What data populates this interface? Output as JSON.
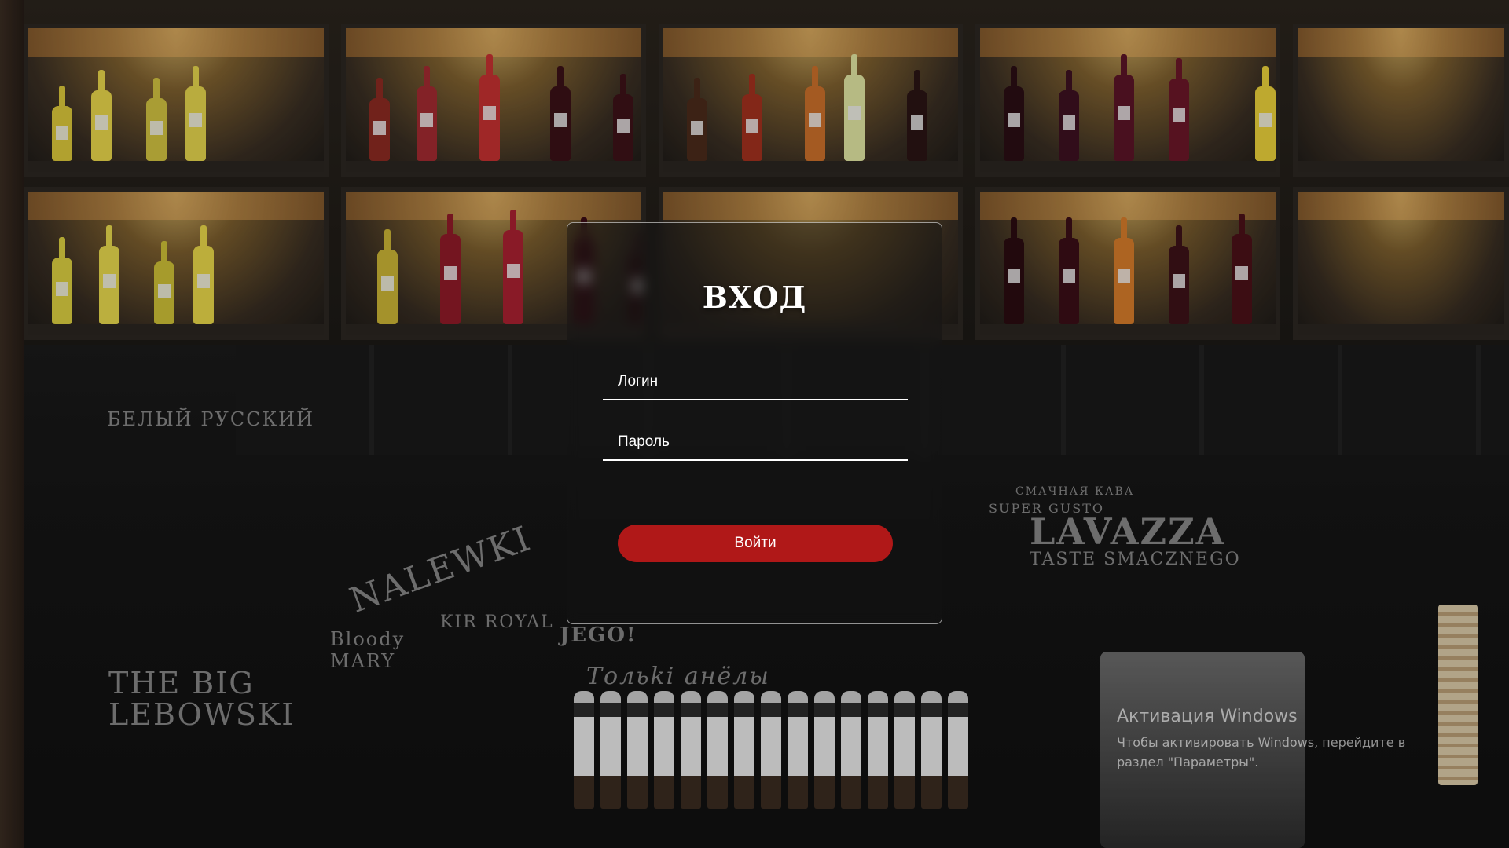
{
  "login_form": {
    "title": "ВХОД",
    "login_placeholder": "Логин",
    "password_placeholder": "Пароль",
    "submit_label": "Войти",
    "accent_color": "#b01818"
  },
  "windows_watermark": {
    "title": "Активация Windows",
    "text": "Чтобы активировать Windows, перейдите в раздел \"Параметры\"."
  },
  "background": {
    "chalk_texts": [
      "БЕЛЫЙ РУССКИЙ",
      "NALEWKI",
      "KIR ROYAL",
      "Bloody MARY",
      "THE BIG LEBOWSKI",
      "LAVAZZA",
      "TASTE SMACZNEGO",
      "SUPER GUSTO",
      "СМАЧНАЯ КАВА",
      "Тольki анёлы",
      "JEGO!"
    ]
  }
}
